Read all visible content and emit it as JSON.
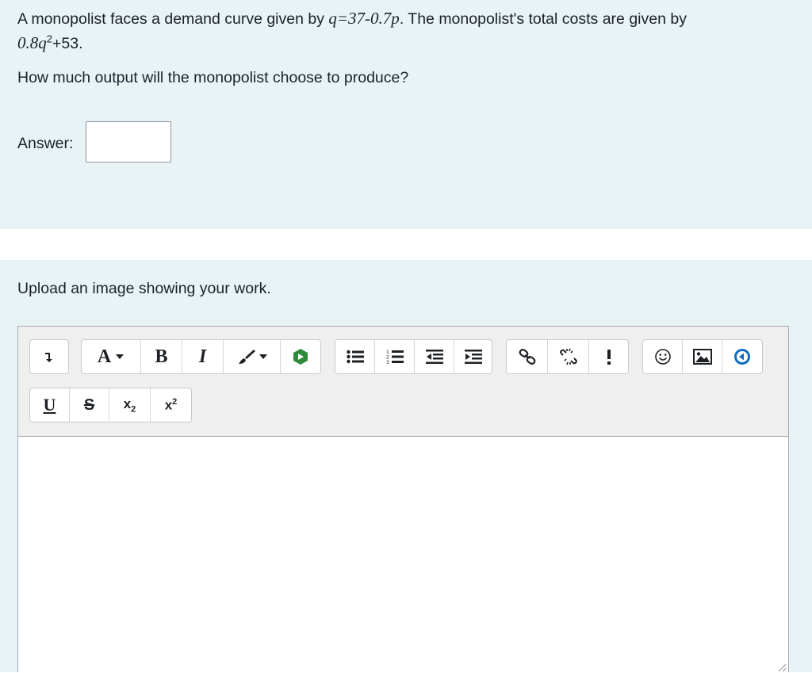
{
  "question": {
    "text_before": "A monopolist faces a demand curve given by ",
    "demand_eq": "q=37-0.7p",
    "text_mid": ". The monopolist's total costs are given by ",
    "cost_base": "0.8q",
    "cost_exp": "2",
    "cost_rest": "+53",
    "text_end": ".",
    "prompt": "How much output will the monopolist choose to produce?",
    "answer_label": "Answer:",
    "answer_value": ""
  },
  "upload": {
    "prompt": "Upload an image showing your work."
  },
  "toolbar": {
    "font_color_label": "A",
    "bold_label": "B",
    "italic_label": "I",
    "underline_label": "U",
    "strike_label": "S",
    "subscript_label": "x",
    "subscript_sub": "2",
    "superscript_label": "x",
    "superscript_sup": "2",
    "accent_color": "#0f6cbf",
    "media_color": "#2e8b3a",
    "icons": [
      "collapse-toggle-icon",
      "font-color-icon",
      "bold-icon",
      "italic-icon",
      "highlight-brush-icon",
      "media-icon",
      "unordered-list-icon",
      "ordered-list-icon",
      "outdent-icon",
      "indent-icon",
      "link-icon",
      "unlink-icon",
      "exclamation-icon",
      "emoji-icon",
      "image-icon",
      "record-audio-icon",
      "underline-icon",
      "strikethrough-icon",
      "subscript-icon",
      "superscript-icon"
    ]
  }
}
